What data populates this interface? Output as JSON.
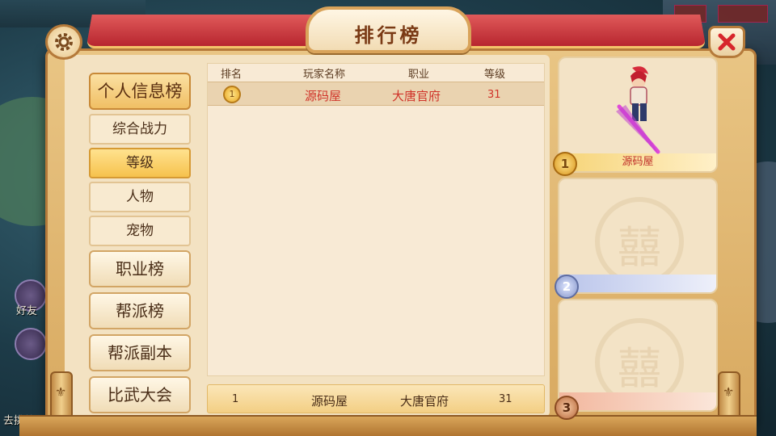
{
  "title": "排行榜",
  "menu": {
    "personal": "个人信息榜",
    "sub": [
      "综合战力",
      "等级",
      "人物",
      "宠物"
    ],
    "active_sub": "等级",
    "profession": "职业榜",
    "guild": "帮派榜",
    "guild_dungeon": "帮派副本",
    "tournament": "比武大会"
  },
  "table": {
    "headers": [
      "排名",
      "玩家名称",
      "职业",
      "等级"
    ],
    "rows": [
      {
        "rank": "1",
        "name": "源码屋",
        "class": "大唐官府",
        "level": "31"
      }
    ],
    "my_rank": {
      "rank": "1",
      "name": "源码屋",
      "class": "大唐官府",
      "level": "31"
    }
  },
  "podium": [
    {
      "place": "1",
      "name": "源码屋"
    },
    {
      "place": "2",
      "name": ""
    },
    {
      "place": "3",
      "name": ""
    }
  ],
  "background_hud": {
    "friend_label": "好友",
    "bottom_label": "去挑战"
  },
  "colors": {
    "accent_red": "#d0342a",
    "frame_gold": "#d8a960",
    "active_tab": "#f6c24d"
  }
}
